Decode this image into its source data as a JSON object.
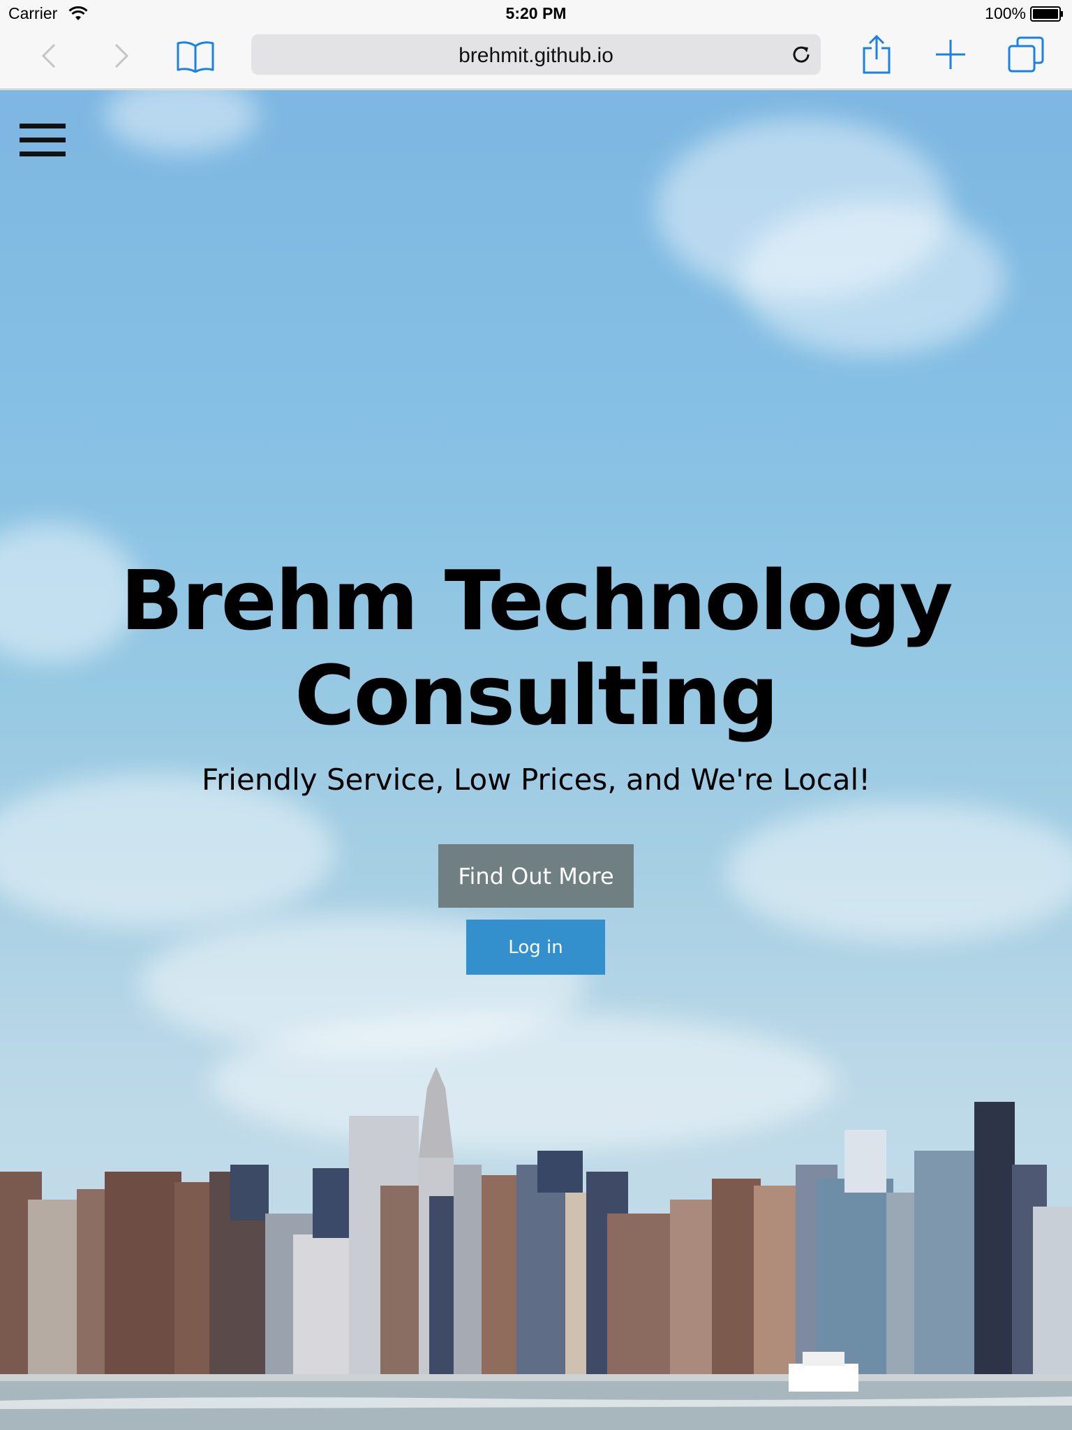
{
  "status_bar": {
    "carrier": "Carrier",
    "time": "5:20 PM",
    "battery": "100%"
  },
  "browser": {
    "url": "brehmit.github.io",
    "icons": [
      "back-chevron-icon",
      "forward-chevron-icon",
      "bookmarks-book-icon",
      "reload-icon",
      "share-icon",
      "new-tab-plus-icon",
      "tabs-icon"
    ],
    "accent": "#1a82e2"
  },
  "page": {
    "title_line1": "Brehm Technology",
    "title_line2": "Consulting",
    "subtitle": "Friendly Service, Low Prices, and We're Local!",
    "find_out_more": "Find Out More",
    "login": "Log in",
    "colors": {
      "find_out_more_bg": "#6f7f82",
      "login_bg": "#3390cc",
      "text": "#000000"
    }
  }
}
